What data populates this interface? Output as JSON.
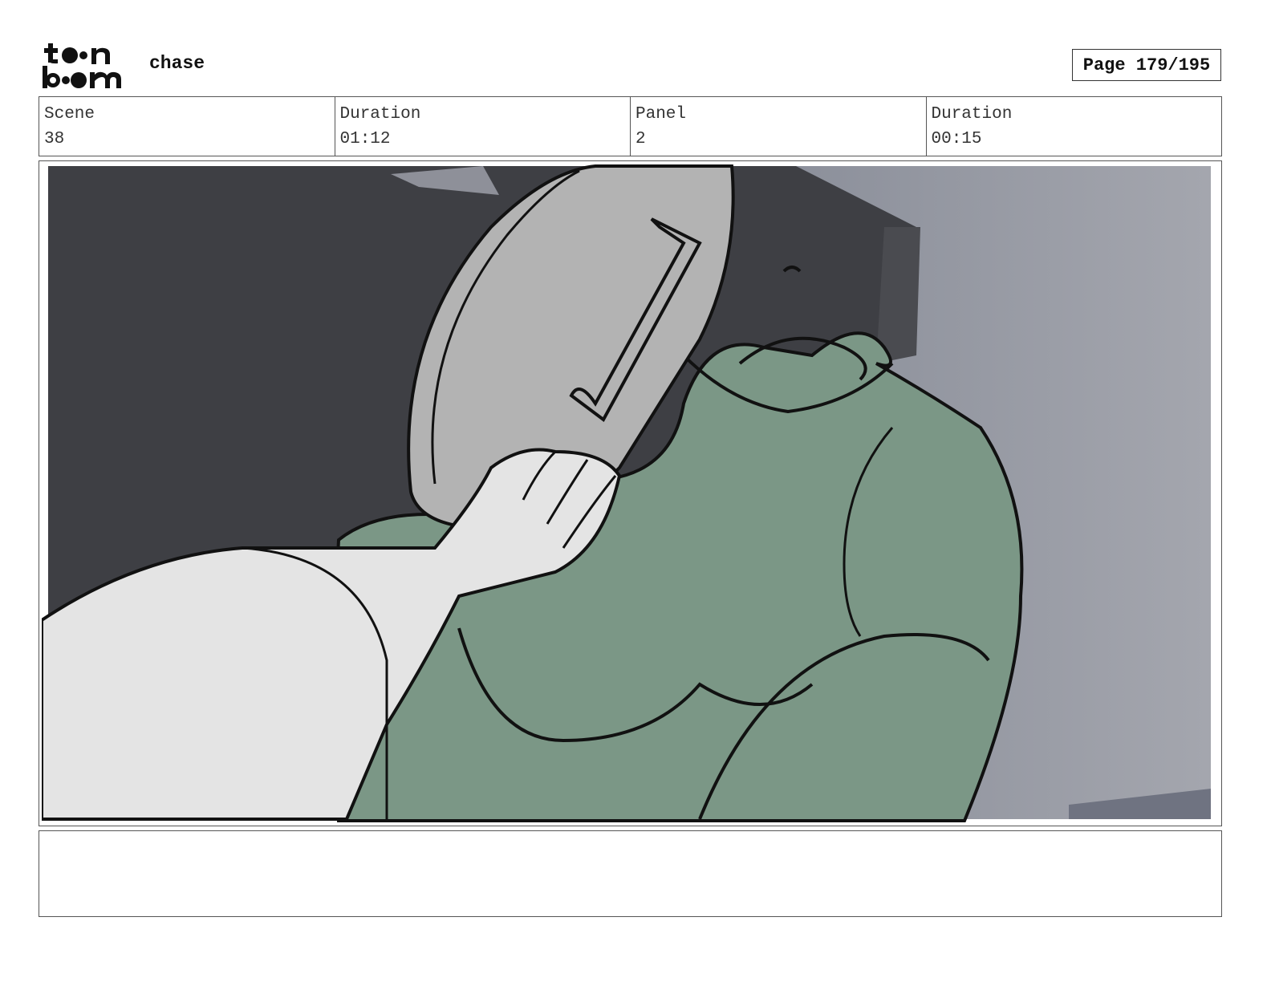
{
  "header": {
    "logo_text": "toon boom",
    "project_title": "chase",
    "page_label": "Page 179/195"
  },
  "info": {
    "scene_label": "Scene",
    "scene_value": "38",
    "scene_duration_label": "Duration",
    "scene_duration_value": "01:12",
    "panel_label": "Panel",
    "panel_value": "2",
    "panel_duration_label": "Duration",
    "panel_duration_value": "00:15"
  },
  "notes": {
    "text": ""
  },
  "colors": {
    "creature_green": "#7b9786",
    "background_dark": "#3e3f44",
    "background_light": "#9a9ca6",
    "lid_gray": "#b3b3b3",
    "arm_white": "#e4e4e4"
  }
}
